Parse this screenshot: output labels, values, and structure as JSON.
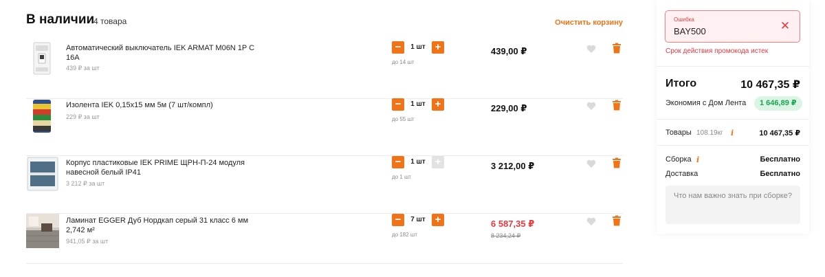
{
  "cart": {
    "title": "В наличии",
    "count": "4 товара",
    "clear_label": "Очистить корзину",
    "items": [
      {
        "name": "Автоматический выключатель IEK ARMAT M06N 1P C 16A",
        "unit_price": "439 ₽ за шт",
        "qty": "1 шт",
        "stock": "до 14 шт",
        "price": "439,00 ₽",
        "old_price": null,
        "plus_enabled": true
      },
      {
        "name": "Изолента IEK 0,15x15 мм 5м (7 шт/компл)",
        "unit_price": "229 ₽ за шт",
        "qty": "1 шт",
        "stock": "до 55 шт",
        "price": "229,00 ₽",
        "old_price": null,
        "plus_enabled": true
      },
      {
        "name": "Корпус пластиковые IEK PRIME ЩРН-П-24 модуля навесной белый IP41",
        "unit_price": "3 212 ₽ за шт",
        "qty": "1 шт",
        "stock": "до 1 шт",
        "price": "3 212,00 ₽",
        "old_price": null,
        "plus_enabled": false
      },
      {
        "name": "Ламинат EGGER Дуб Нордкап серый 31 класс 6 мм 2,742 м²",
        "unit_price": "941,05 ₽ за шт",
        "qty": "7 шт",
        "stock": "до 182 шт",
        "price": "6 587,35 ₽",
        "old_price": "8 234,24 ₽",
        "plus_enabled": true
      }
    ],
    "minus_label": "−",
    "plus_label": "+"
  },
  "summary": {
    "promo": {
      "label": "Ошибка",
      "value": "BAY500",
      "close_label": "✕",
      "error": "Срок действия промокода истек"
    },
    "total_label": "Итого",
    "total_value": "10 467,35 ₽",
    "economy_label": "Экономия с Дом Лента",
    "economy_value": "1 646,89 ₽",
    "goods_label": "Товары",
    "goods_weight": "108.19кг",
    "goods_value": "10 467,35 ₽",
    "assembly_label": "Сборка",
    "assembly_value": "Бесплатно",
    "delivery_label": "Доставка",
    "delivery_value": "Бесплатно",
    "info_glyph": "i",
    "note_placeholder": "Что нам важно знать при сборке?"
  },
  "colors": {
    "accent": "#f07317",
    "error": "#e8383d",
    "economy_bg": "#dbf5e4",
    "economy_text": "#1aa350"
  }
}
